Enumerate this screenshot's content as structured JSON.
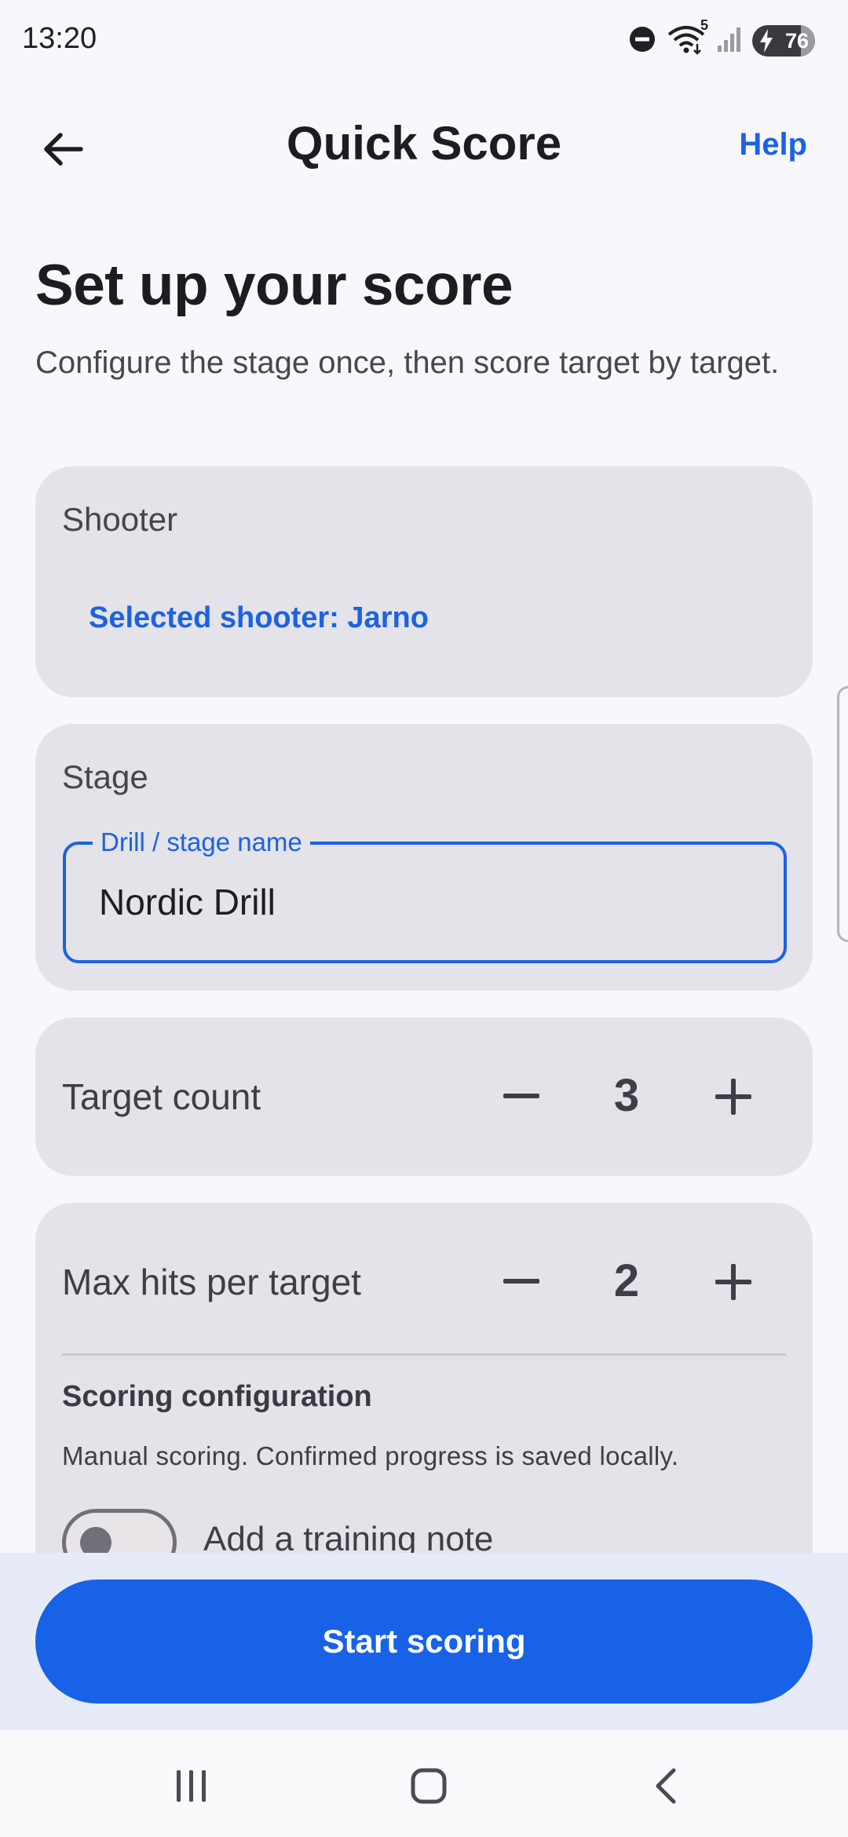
{
  "status_bar": {
    "time": "13:20",
    "battery_level": "76",
    "wifi_badge": "5",
    "icons": [
      "do-not-disturb-icon",
      "wifi-icon",
      "signal-icon",
      "battery-charging-icon"
    ]
  },
  "app_bar": {
    "title": "Quick Score",
    "help_label": "Help",
    "back_icon": "arrow-left-icon"
  },
  "header": {
    "heading": "Set up your score",
    "subtitle": "Configure the stage once, then score target by target."
  },
  "shooter": {
    "section_title": "Shooter",
    "selected_text": "Selected shooter: Jarno"
  },
  "stage": {
    "section_title": "Stage",
    "field_label": "Drill / stage name",
    "field_value": "Nordic Drill"
  },
  "target_count": {
    "label": "Target count",
    "value": "3"
  },
  "max_hits": {
    "label": "Max hits per target",
    "value": "2"
  },
  "scoring": {
    "title": "Scoring configuration",
    "description": "Manual scoring. Confirmed progress is saved locally.",
    "training_note_label": "Add a training note",
    "training_note_enabled": false
  },
  "actions": {
    "start_label": "Start scoring"
  },
  "colors": {
    "accent": "#1d62e0",
    "primary_button": "#1862e8",
    "card_background": "#e3e3e9",
    "page_background": "#f8f8fc"
  }
}
